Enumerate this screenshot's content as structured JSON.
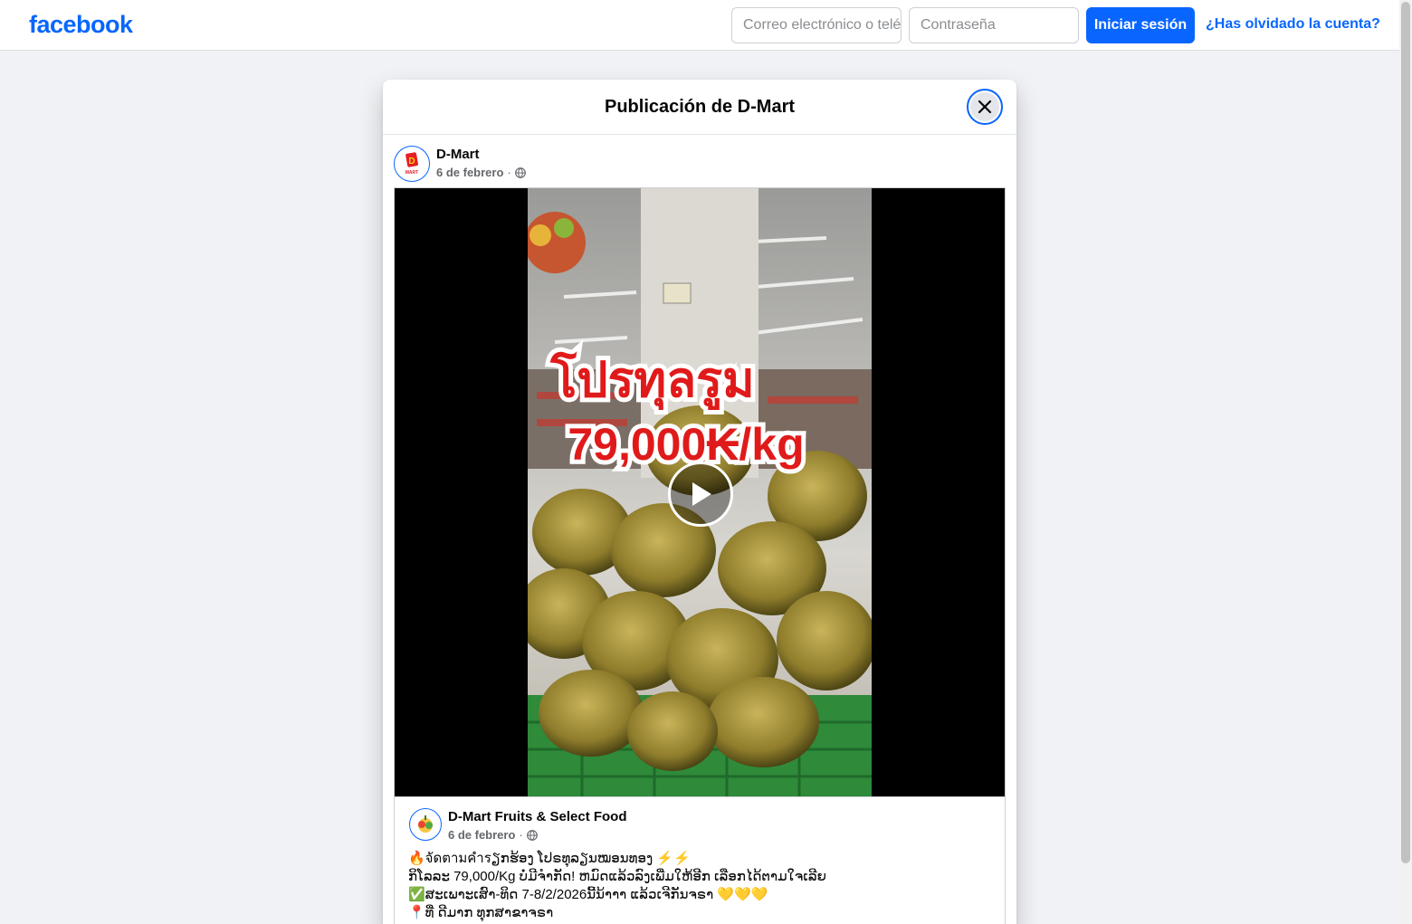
{
  "topbar": {
    "logo": "facebook",
    "email_placeholder": "Correo electrónico o teléfono",
    "password_placeholder": "Contraseña",
    "login_label": "Iniciar sesión",
    "forgot_label": "¿Has olvidado la cuenta?"
  },
  "dialog": {
    "title": "Publicación de D-Mart",
    "close_icon": "close-icon"
  },
  "post": {
    "author": "D-Mart",
    "date": "6 de febrero",
    "separator": "·",
    "audience_icon": "globe-icon",
    "video": {
      "overlay_line1": "โปรทุลรูม",
      "overlay_line2": "79,000₭/kg",
      "play_icon": "play-icon"
    }
  },
  "shared_post": {
    "author": "D-Mart Fruits & Select Food",
    "date": "6 de febrero",
    "separator": "·",
    "audience_icon": "globe-icon",
    "caption": [
      "🔥จัดตามคำรຽກຮ້ອງ ໂປຣທຸລຽນໝອນທອງ ⚡⚡",
      "ກິໂລລະ 79,000/Kg ບໍ່ມີຈຳກັດ! ຫມົດແລ້ວລົງເພີ່ມໃຫ້ອີກ ເລືອກໄດ້ຕາມໃຈເລີຍ",
      "✅ສະເພາະເສົາ-ທິດ  7-8/2/2026ນີ້ນ້າາາ ແລ້ວເຈີກັນຈຣາ 💛💛💛",
      "📍ທີ່ ດີມາກ ທຸກສາຂາຈຣາ"
    ]
  },
  "colors": {
    "brand": "#0866ff",
    "background": "#f0f2f5",
    "secondary_text": "#65676b"
  }
}
